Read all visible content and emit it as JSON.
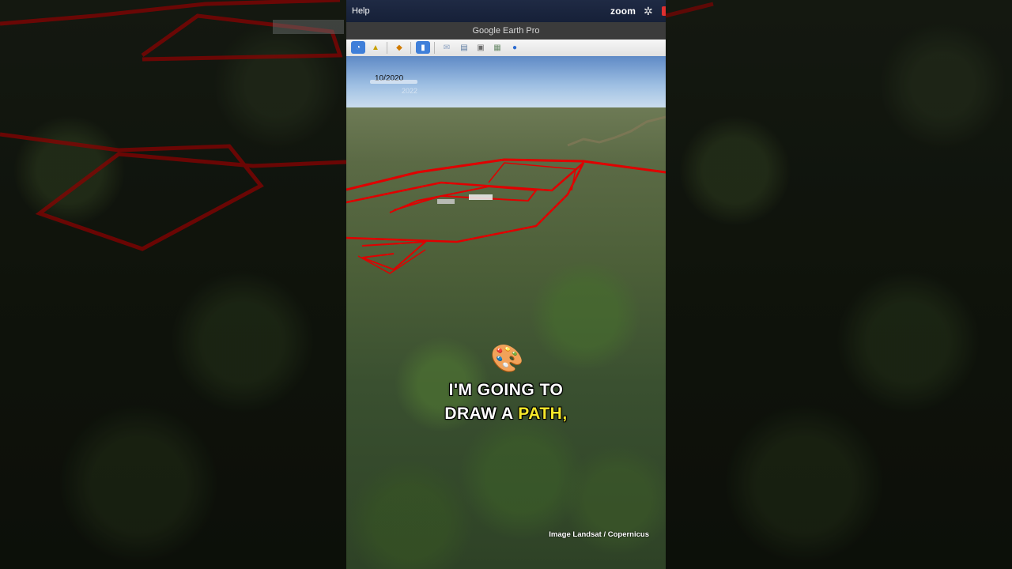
{
  "menubar": {
    "help_label": "Help",
    "zoom_label": "zoom",
    "gear_icon": "gear-icon"
  },
  "window": {
    "title": "Google Earth Pro"
  },
  "toolbar": {
    "icons": [
      "hide-sidebar-icon",
      "placemark-icon",
      "polygon-icon",
      "path-icon",
      "overlay-icon",
      "email-icon",
      "print-icon",
      "view-in-maps-icon",
      "historical-imagery-icon",
      "sun-icon"
    ]
  },
  "viewer": {
    "time_label": "10/2020",
    "time_end_label": "2022",
    "credit": "Image Landsat / Copernicus"
  },
  "caption": {
    "emoji": "🎨",
    "line1": "I'M GOING TO",
    "line2_a": "DRAW A",
    "line2_b": "PATH,"
  },
  "colors": {
    "path_red": "#e00000",
    "highlight": "#f5e82a",
    "toolbar_active": "#3f7fd9"
  }
}
